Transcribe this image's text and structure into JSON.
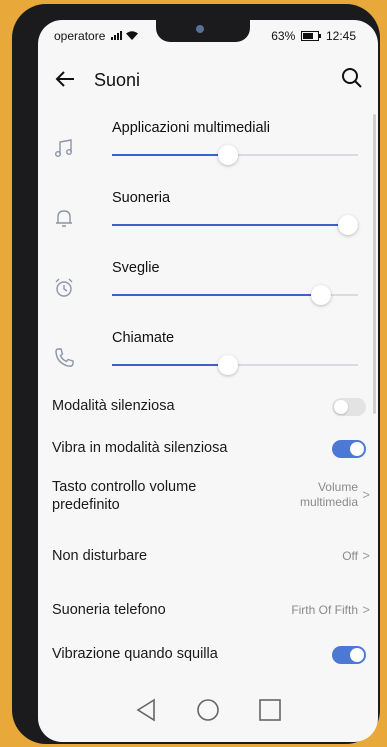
{
  "status": {
    "carrier": "operatore",
    "battery": "63%",
    "time": "12:45"
  },
  "header": {
    "title": "Suoni"
  },
  "volume": [
    {
      "label": "Applicazioni multimediali",
      "icon": "music-note-icon",
      "level": 0.47
    },
    {
      "label": "Suoneria",
      "icon": "bell-icon",
      "level": 1.0
    },
    {
      "label": "Sveglie",
      "icon": "alarm-clock-icon",
      "level": 0.85
    },
    {
      "label": "Chiamate",
      "icon": "phone-icon",
      "level": 0.47
    }
  ],
  "settings": {
    "silent_mode": {
      "label": "Modalità silenziosa",
      "on": false
    },
    "vibrate_silent": {
      "label": "Vibra in modalità silenziosa",
      "on": true
    },
    "volume_key": {
      "label_line1": "Tasto controllo volume",
      "label_line2": "predefinito",
      "value_line1": "Volume",
      "value_line2": "multimedia"
    },
    "dnd": {
      "label": "Non disturbare",
      "value": "Off"
    },
    "ringtone": {
      "label": "Suoneria telefono",
      "value": "Firth Of Fifth"
    },
    "vibrate_ring": {
      "label": "Vibrazione quando squilla",
      "on": true
    }
  },
  "colors": {
    "accent": "#3b63c9",
    "toggle_on": "#4d78d6",
    "background": "#f7f7f7",
    "frame": "#e8a93a"
  }
}
